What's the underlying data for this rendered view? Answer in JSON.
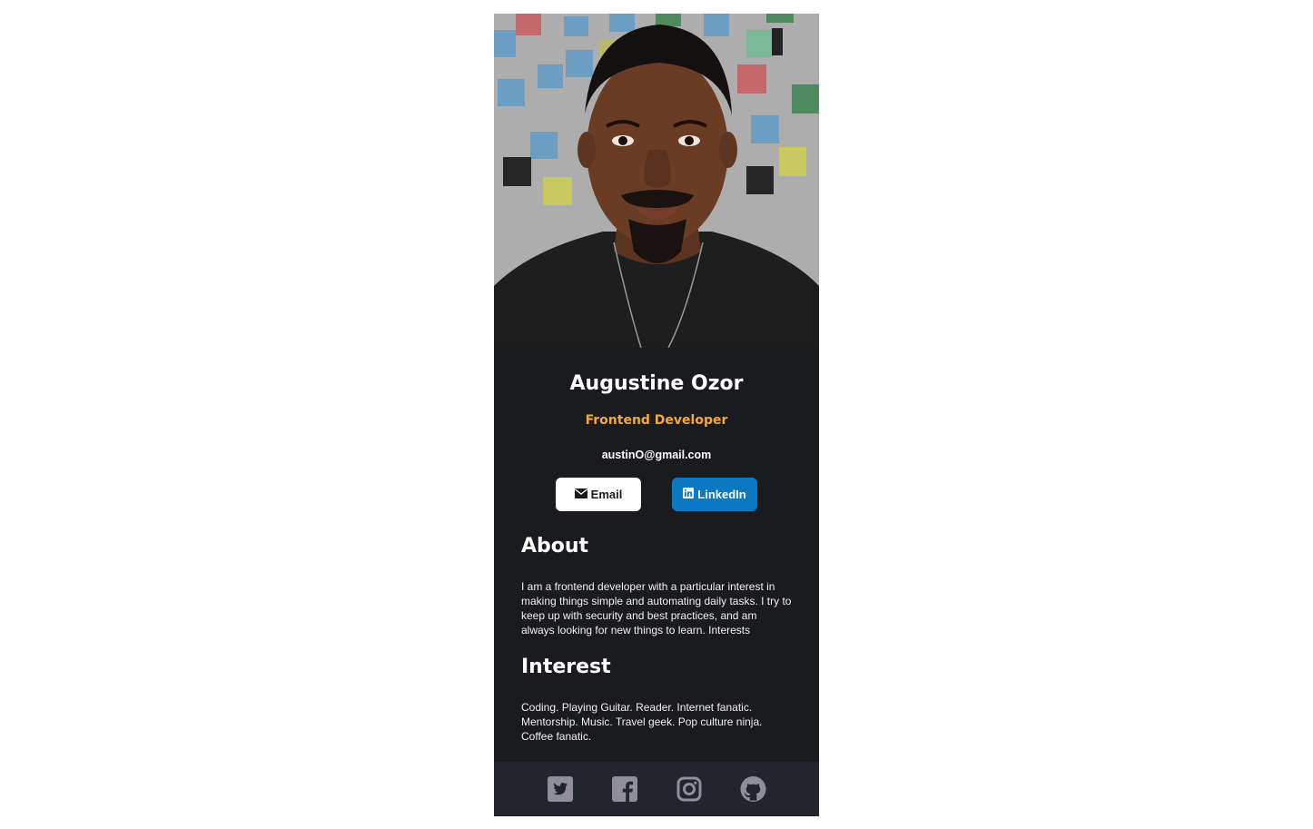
{
  "profile": {
    "name": "Augustine Ozor",
    "role": "Frontend Developer",
    "email": "austinO@gmail.com",
    "photo_alt": "Augustine Ozor"
  },
  "buttons": {
    "email_label": "Email",
    "email_icon": "envelope-icon",
    "linkedin_label": "LinkedIn",
    "linkedin_icon": "linkedin-icon"
  },
  "about": {
    "heading": "About",
    "text": "I am a frontend developer with a particular interest in making things simple and automating daily tasks. I try to keep up with security and best practices, and am always looking for new things to learn. Interests"
  },
  "interest": {
    "heading": "Interest",
    "text": "Coding. Playing Guitar. Reader. Internet fanatic. Mentorship. Music. Travel geek. Pop culture ninja. Coffee fanatic."
  },
  "footer": {
    "icons": [
      "twitter-icon",
      "facebook-icon",
      "instagram-icon",
      "github-icon"
    ]
  },
  "colors": {
    "card_bg": "#1a1b1f",
    "footer_bg": "#22252c",
    "accent": "#f3a93a",
    "linkedin": "#0a78c2",
    "icon": "#918e9b"
  }
}
